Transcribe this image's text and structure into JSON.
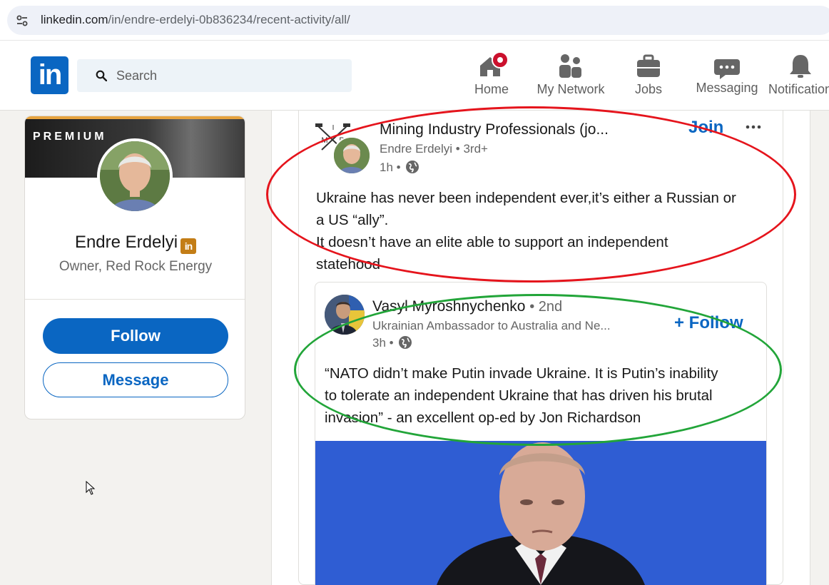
{
  "browser": {
    "url_host": "linkedin.com",
    "url_path": "/in/endre-erdelyi-0b836234/recent-activity/all/"
  },
  "header": {
    "logo_text": "in",
    "search_placeholder": "Search",
    "nav": [
      {
        "label": "Home",
        "icon": "home-icon"
      },
      {
        "label": "My Network",
        "icon": "network-icon"
      },
      {
        "label": "Jobs",
        "icon": "briefcase-icon"
      },
      {
        "label": "Messaging",
        "icon": "messaging-icon"
      },
      {
        "label": "Notifications",
        "icon": "bell-icon"
      }
    ]
  },
  "profile": {
    "banner_label": "PREMIUM",
    "name": "Endre Erdelyi",
    "badge": "in",
    "headline": "Owner, Red Rock Energy",
    "follow_label": "Follow",
    "message_label": "Message"
  },
  "posts": [
    {
      "group_name": "Mining Industry Professionals (jo...",
      "actor": "Endre Erdelyi",
      "actor_degree": "• 3rd+",
      "time": "1h •",
      "action_label": "Join",
      "body_lines": [
        "Ukraine has never been independent ever,it’s either a Russian or",
        "a US “ally”.",
        "It doesn’t have an elite able to support an independent",
        "statehood"
      ]
    },
    {
      "author": "Vasyl Myroshnychenko",
      "degree": "• 2nd",
      "headline": "Ukrainian Ambassador to Australia and Ne...",
      "time": "3h •",
      "action_label": "+ Follow",
      "body_lines": [
        "“NATO didn’t make Putin invade Ukraine. It is Putin’s inability",
        "to tolerate an independent Ukraine that has driven his brutal",
        "invasion” - an excellent op-ed by Jon Richardson"
      ]
    }
  ],
  "colors": {
    "linkedin_blue": "#0a66c2",
    "annotation_red": "#e5141c",
    "annotation_green": "#22a539",
    "notification_red": "#cb112d"
  }
}
